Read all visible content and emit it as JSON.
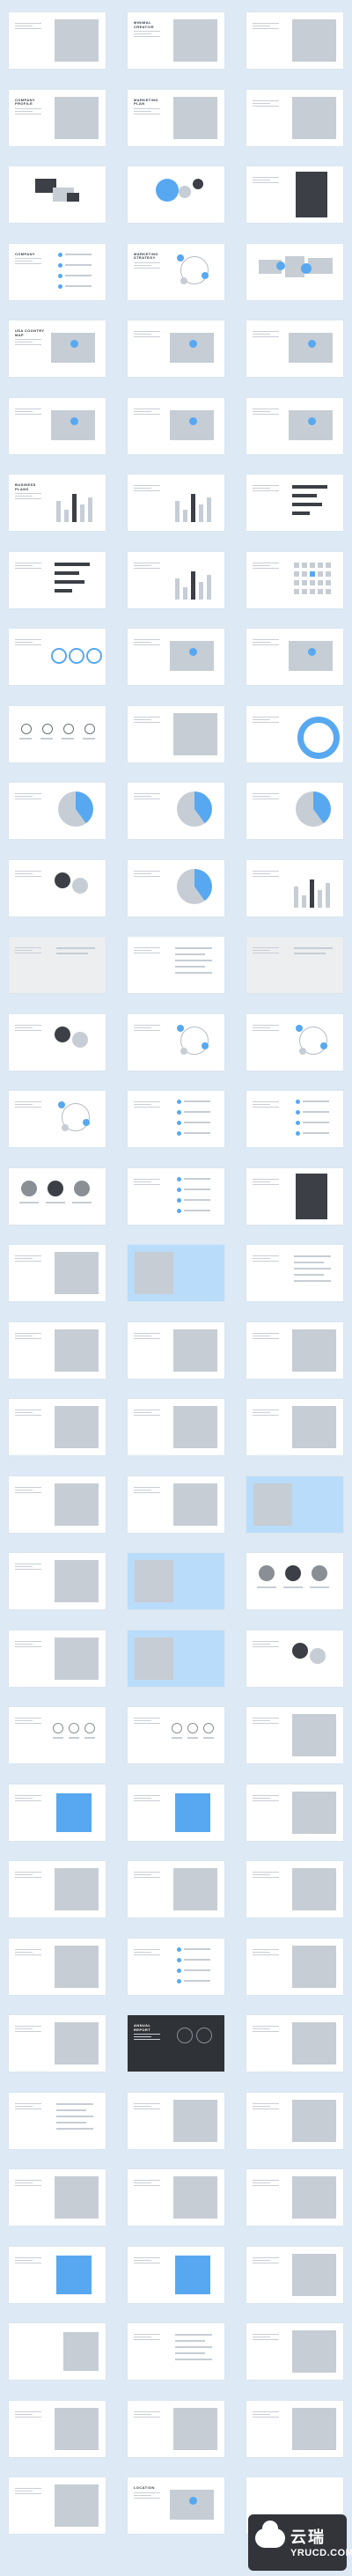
{
  "background_color": "#dde9f4",
  "slides": [
    {
      "title": "",
      "v": "photo"
    },
    {
      "title": "Minimal creative",
      "v": "photo"
    },
    {
      "title": "",
      "v": "photo"
    },
    {
      "title": "Company profile",
      "v": "photo"
    },
    {
      "title": "Marketing plan",
      "v": "photo"
    },
    {
      "title": "",
      "v": "photo"
    },
    {
      "title": "",
      "v": "devices"
    },
    {
      "title": "",
      "v": "bubbles"
    },
    {
      "title": "",
      "v": "person"
    },
    {
      "title": "Company",
      "v": "list"
    },
    {
      "title": "Marketing strategy",
      "v": "cycle"
    },
    {
      "title": "",
      "v": "worldmap"
    },
    {
      "title": "USA COUNTRY MAP",
      "v": "map"
    },
    {
      "title": "",
      "v": "map"
    },
    {
      "title": "",
      "v": "map"
    },
    {
      "title": "",
      "v": "map"
    },
    {
      "title": "",
      "v": "map"
    },
    {
      "title": "",
      "v": "map"
    },
    {
      "title": "Business plans",
      "v": "bars"
    },
    {
      "title": "",
      "v": "bars"
    },
    {
      "title": "",
      "v": "hbars"
    },
    {
      "title": "",
      "v": "hbars"
    },
    {
      "title": "",
      "v": "bars"
    },
    {
      "title": "",
      "v": "calendar"
    },
    {
      "title": "",
      "v": "stats"
    },
    {
      "title": "",
      "v": "map"
    },
    {
      "title": "",
      "v": "map"
    },
    {
      "title": "",
      "v": "icons"
    },
    {
      "title": "",
      "v": "photo"
    },
    {
      "title": "",
      "v": "donut"
    },
    {
      "title": "",
      "v": "pie"
    },
    {
      "title": "",
      "v": "pie"
    },
    {
      "title": "",
      "v": "pie"
    },
    {
      "title": "",
      "v": "circles"
    },
    {
      "title": "",
      "v": "pie"
    },
    {
      "title": "",
      "v": "bars"
    },
    {
      "title": "",
      "v": "gray"
    },
    {
      "title": "",
      "v": "text"
    },
    {
      "title": "",
      "v": "gray"
    },
    {
      "title": "",
      "v": "circles"
    },
    {
      "title": "",
      "v": "cycle"
    },
    {
      "title": "",
      "v": "cycle"
    },
    {
      "title": "",
      "v": "cycle"
    },
    {
      "title": "",
      "v": "list"
    },
    {
      "title": "",
      "v": "list"
    },
    {
      "title": "",
      "v": "team"
    },
    {
      "title": "",
      "v": "list"
    },
    {
      "title": "",
      "v": "person"
    },
    {
      "title": "",
      "v": "photo"
    },
    {
      "title": "",
      "v": "bluephoto"
    },
    {
      "title": "",
      "v": "text"
    },
    {
      "title": "",
      "v": "photo"
    },
    {
      "title": "",
      "v": "photo"
    },
    {
      "title": "",
      "v": "photo"
    },
    {
      "title": "",
      "v": "photo"
    },
    {
      "title": "",
      "v": "photo"
    },
    {
      "title": "",
      "v": "photo"
    },
    {
      "title": "",
      "v": "photo"
    },
    {
      "title": "",
      "v": "photo"
    },
    {
      "title": "",
      "v": "bluephoto"
    },
    {
      "title": "",
      "v": "photo"
    },
    {
      "title": "",
      "v": "bluephoto"
    },
    {
      "title": "",
      "v": "team"
    },
    {
      "title": "",
      "v": "photo"
    },
    {
      "title": "",
      "v": "bluephoto"
    },
    {
      "title": "",
      "v": "circles"
    },
    {
      "title": "",
      "v": "numbers"
    },
    {
      "title": "",
      "v": "numbers"
    },
    {
      "title": "",
      "v": "photo"
    },
    {
      "title": "",
      "v": "bignum"
    },
    {
      "title": "",
      "v": "bignum"
    },
    {
      "title": "",
      "v": "photo"
    },
    {
      "title": "",
      "v": "photo"
    },
    {
      "title": "",
      "v": "photo"
    },
    {
      "title": "",
      "v": "photo"
    },
    {
      "title": "",
      "v": "photo"
    },
    {
      "title": "",
      "v": "list"
    },
    {
      "title": "",
      "v": "photo"
    },
    {
      "title": "",
      "v": "photo"
    },
    {
      "title": "Annual report",
      "v": "dark"
    },
    {
      "title": "",
      "v": "photo"
    },
    {
      "title": "",
      "v": "text"
    },
    {
      "title": "",
      "v": "photo"
    },
    {
      "title": "",
      "v": "photo"
    },
    {
      "title": "",
      "v": "photo"
    },
    {
      "title": "",
      "v": "photo"
    },
    {
      "title": "",
      "v": "photo"
    },
    {
      "title": "",
      "v": "bignum"
    },
    {
      "title": "",
      "v": "bignum"
    },
    {
      "title": "",
      "v": "photo"
    },
    {
      "title": "",
      "v": "space"
    },
    {
      "title": "",
      "v": "text"
    },
    {
      "title": "",
      "v": "photo"
    },
    {
      "title": "",
      "v": "photo"
    },
    {
      "title": "",
      "v": "photo"
    },
    {
      "title": "",
      "v": "photo"
    },
    {
      "title": "",
      "v": "photo"
    },
    {
      "title": "LOCATION",
      "v": "map"
    },
    {
      "title": "",
      "v": "blank"
    }
  ],
  "watermark": {
    "cn": "云瑞",
    "en": "YRUCD.COM"
  }
}
